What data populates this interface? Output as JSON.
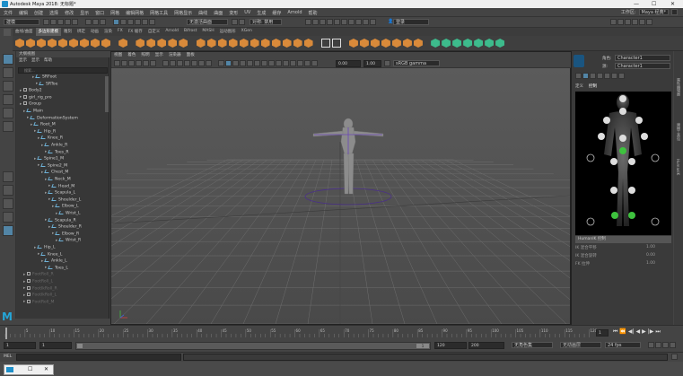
{
  "window": {
    "title": "Autodesk Maya 2018: 无标题*"
  },
  "menubar": {
    "items": [
      "文件",
      "编辑",
      "创建",
      "选择",
      "修改",
      "显示",
      "窗口",
      "网格",
      "编辑网格",
      "网格工具",
      "网格显示",
      "曲线",
      "曲面",
      "变形",
      "UV",
      "生成",
      "缓存",
      "Arnold",
      "帮助"
    ],
    "workspace_label": "工作区:",
    "workspace_value": "Maya 经典*"
  },
  "statusline": {
    "mode_select": "建模",
    "no_live_surface": "无激活曲面",
    "symmetry": "对称: 禁用",
    "login": "登录"
  },
  "shelf": {
    "tabs": [
      "曲线/曲面",
      "多边形建模",
      "雕刻",
      "绑定",
      "动画",
      "渲染",
      "FX",
      "FX 缓存",
      "自定义",
      "Arnold",
      "Bifrost",
      "MASH",
      "运动图形",
      "XGen"
    ],
    "active_tab": "多边形建模"
  },
  "outliner": {
    "title": "大纲视图",
    "menu": [
      "显示",
      "显示",
      "帮助"
    ],
    "search_placeholder": "搜索...",
    "rows": [
      {
        "label": "SRFoot",
        "indent": 9,
        "type": "joint",
        "dim": false
      },
      {
        "label": "SRToe",
        "indent": 11,
        "type": "joint",
        "dim": false
      },
      {
        "label": "Body2",
        "indent": 2,
        "type": "group",
        "dim": false
      },
      {
        "label": "girl_rig_pro",
        "indent": 2,
        "type": "group",
        "dim": false
      },
      {
        "label": "Group",
        "indent": 2,
        "type": "group",
        "dim": false
      },
      {
        "label": "Main",
        "indent": 4,
        "type": "joint",
        "dim": false
      },
      {
        "label": "DeformationSystem",
        "indent": 6,
        "type": "joint",
        "dim": false
      },
      {
        "label": "Root_M",
        "indent": 8,
        "type": "joint",
        "dim": false
      },
      {
        "label": "Hip_R",
        "indent": 10,
        "type": "joint",
        "dim": false
      },
      {
        "label": "Knee_R",
        "indent": 12,
        "type": "joint",
        "dim": false
      },
      {
        "label": "Ankle_R",
        "indent": 14,
        "type": "joint",
        "dim": false
      },
      {
        "label": "Toes_R",
        "indent": 16,
        "type": "joint",
        "dim": false
      },
      {
        "label": "Spine1_M",
        "indent": 10,
        "type": "joint",
        "dim": false
      },
      {
        "label": "Spine2_M",
        "indent": 12,
        "type": "joint",
        "dim": false
      },
      {
        "label": "Chest_M",
        "indent": 14,
        "type": "joint",
        "dim": false
      },
      {
        "label": "Neck_M",
        "indent": 16,
        "type": "joint",
        "dim": false
      },
      {
        "label": "Head_M",
        "indent": 18,
        "type": "joint",
        "dim": false
      },
      {
        "label": "Scapula_L",
        "indent": 16,
        "type": "joint",
        "dim": false
      },
      {
        "label": "Shoulder_L",
        "indent": 18,
        "type": "joint",
        "dim": false
      },
      {
        "label": "Elbow_L",
        "indent": 20,
        "type": "joint",
        "dim": false
      },
      {
        "label": "Wrist_L",
        "indent": 22,
        "type": "joint",
        "dim": false
      },
      {
        "label": "Scapula_R",
        "indent": 16,
        "type": "joint",
        "dim": false
      },
      {
        "label": "Shoulder_R",
        "indent": 18,
        "type": "joint",
        "dim": false
      },
      {
        "label": "Elbow_R",
        "indent": 20,
        "type": "joint",
        "dim": false
      },
      {
        "label": "Wrist_R",
        "indent": 22,
        "type": "joint",
        "dim": false
      },
      {
        "label": "Hip_L",
        "indent": 10,
        "type": "joint",
        "dim": false
      },
      {
        "label": "Knee_L",
        "indent": 12,
        "type": "joint",
        "dim": false
      },
      {
        "label": "Ankle_L",
        "indent": 14,
        "type": "joint",
        "dim": false
      },
      {
        "label": "Toes_L",
        "indent": 16,
        "type": "joint",
        "dim": false
      },
      {
        "label": "FootRoll_R",
        "indent": 4,
        "type": "group",
        "dim": true
      },
      {
        "label": "FootRoll_L",
        "indent": 4,
        "type": "group",
        "dim": true
      },
      {
        "label": "FootIkRoll_R",
        "indent": 4,
        "type": "group",
        "dim": true
      },
      {
        "label": "FootIkRoll_L",
        "indent": 4,
        "type": "group",
        "dim": true
      },
      {
        "label": "FootRoll_M",
        "indent": 4,
        "type": "group",
        "dim": true
      }
    ]
  },
  "viewport": {
    "menu": [
      "视图",
      "着色",
      "照明",
      "显示",
      "渲染器",
      "面板"
    ],
    "exposure": "0.00",
    "gamma": "1.00",
    "color_space": "sRGB gamma",
    "camera_label": "persp"
  },
  "hik": {
    "source_label": "角色:",
    "source_value": "Character1",
    "char_label": "源:",
    "char_value": "Character1",
    "tabs": [
      "定义",
      "控制"
    ],
    "panel_label": "HumanIK 控制",
    "props": [
      {
        "label": "IK 混合平移",
        "value": "1.00"
      },
      {
        "label": "IK 混合旋转",
        "value": "0.00"
      },
      {
        "label": "FK 拉伸",
        "value": "1.00"
      }
    ],
    "side_tabs": [
      "属性编辑器",
      "建模工具包",
      "HumanIK"
    ]
  },
  "timeslider": {
    "ticks": [
      "5",
      "10",
      "15",
      "20",
      "25",
      "30",
      "35",
      "40",
      "45",
      "50",
      "55",
      "60",
      "65",
      "70",
      "75",
      "80",
      "85",
      "90",
      "95",
      "100",
      "105",
      "110",
      "115",
      "120"
    ],
    "current_frame": "1"
  },
  "range": {
    "start": "1",
    "start_inner": "1",
    "current": "1",
    "end_inner": "120",
    "end": "120",
    "end_outer": "200",
    "char_set": "无角色集",
    "anim_layer": "无动画层",
    "fps": "24 fps"
  },
  "cmdline": {
    "label": "MEL"
  }
}
